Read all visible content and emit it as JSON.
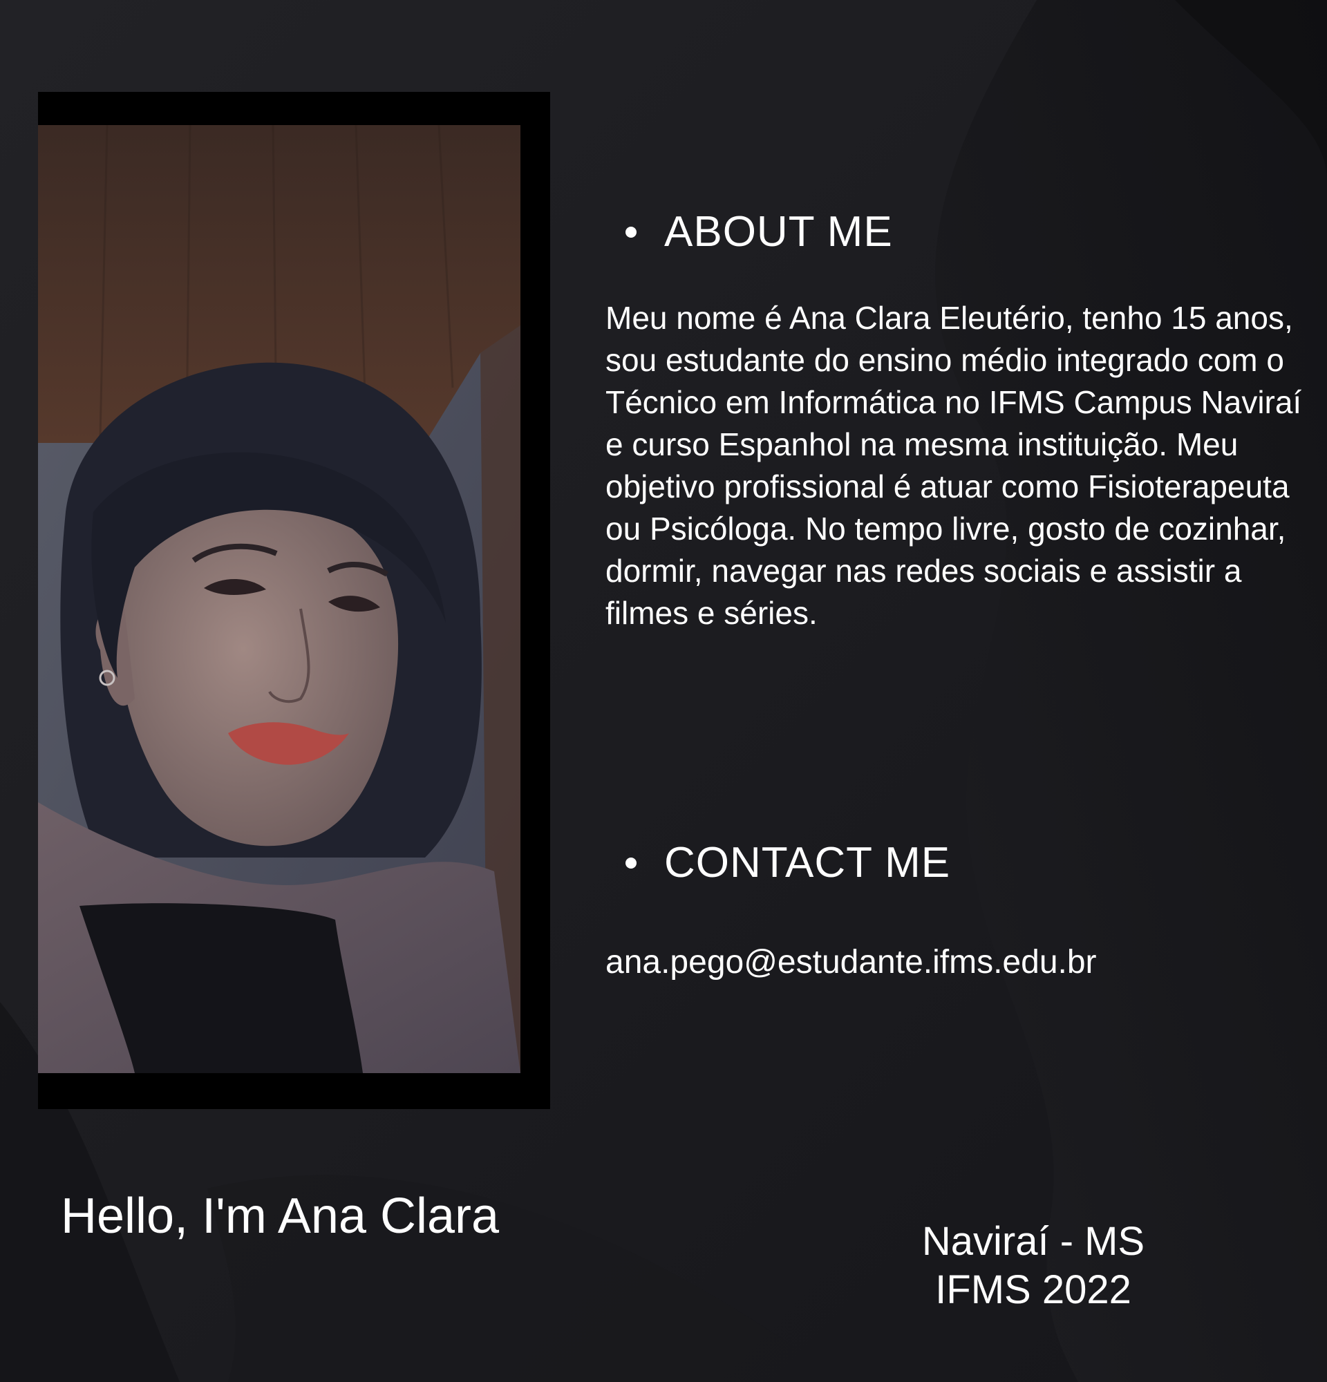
{
  "profile": {
    "photo_alt": "Portrait photo of Ana Clara",
    "greeting": "Hello, I'm Ana Clara"
  },
  "about": {
    "heading": "ABOUT ME",
    "text": "Meu nome é Ana Clara Eleutério, tenho 15 anos, sou estudante do ensino médio integrado com o Técnico em Informática no IFMS Campus Naviraí e curso Espanhol na mesma instituição. Meu objetivo profissional é atuar como Fisioterapeuta ou Psicóloga. No tempo livre, gosto de cozinhar, dormir, navegar nas redes sociais e assistir a filmes e séries."
  },
  "contact": {
    "heading": "CONTACT ME",
    "email": "ana.pego@estudante.ifms.edu.br"
  },
  "footer": {
    "location": "Naviraí - MS",
    "institution": "IFMS 2022"
  },
  "colors": {
    "background": "#1c1c1f",
    "text": "#ffffff",
    "frame": "#000000"
  }
}
